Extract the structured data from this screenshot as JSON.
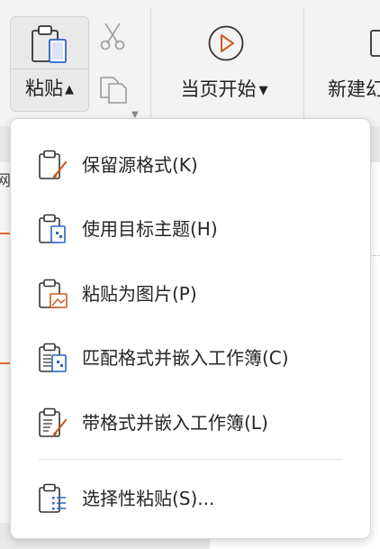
{
  "ribbon": {
    "paste_label": "粘贴",
    "from_current_label": "当页开始",
    "new_label": "新建幻"
  },
  "side_char": "网",
  "colors": {
    "accent": "#e36c2d",
    "icon_blue": "#2b63c9",
    "icon_orange": "#c75a1c"
  },
  "paste_menu": {
    "items": [
      {
        "label": "保留源格式(K)",
        "icon": "clipboard-brush-icon"
      },
      {
        "label": "使用目标主题(H)",
        "icon": "clipboard-theme-icon"
      },
      {
        "label": "粘贴为图片(P)",
        "icon": "clipboard-picture-icon"
      },
      {
        "label": "匹配格式并嵌入工作簿(C)",
        "icon": "clipboard-embed-theme-icon"
      },
      {
        "label": "带格式并嵌入工作簿(L)",
        "icon": "clipboard-embed-brush-icon"
      },
      {
        "label": "选择性粘贴(S)...",
        "icon": "clipboard-list-icon"
      }
    ]
  }
}
